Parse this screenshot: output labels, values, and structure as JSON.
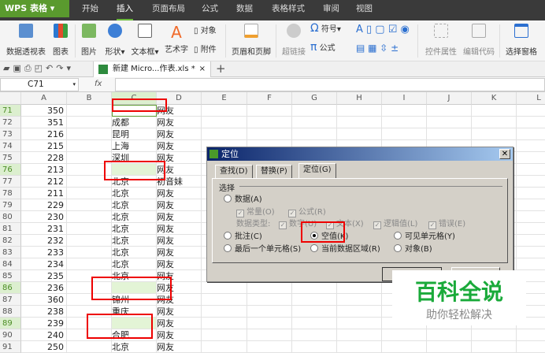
{
  "app": {
    "title": "WPS 表格",
    "menu_tabs": [
      "开始",
      "插入",
      "页面布局",
      "公式",
      "数据",
      "表格样式",
      "审阅",
      "视图"
    ],
    "active_tab": "插入"
  },
  "ribbon": {
    "pivot": "数据透视表",
    "chart": "图表",
    "picture": "图片",
    "shape": "形状",
    "textbox": "文本框",
    "wordart": "艺术字",
    "object": "对象",
    "attachment": "附件",
    "header_footer": "页眉和页脚",
    "hyperlink": "超链接",
    "symbol": "符号",
    "formula": "公式",
    "control_props": "控件属性",
    "edit_code": "编辑代码",
    "select_pane": "选择窗格"
  },
  "doc_tab": {
    "name": "新建 Micro...作表.xls *",
    "close": "×",
    "add": "+"
  },
  "formula_bar": {
    "name_box": "C71",
    "fx": "fx",
    "value": ""
  },
  "columns": [
    "A",
    "B",
    "C",
    "D",
    "E",
    "F",
    "G",
    "H",
    "I",
    "J",
    "K",
    "L"
  ],
  "rows": [
    {
      "n": "71",
      "a": "350",
      "c": "",
      "d": "网友",
      "sel": true
    },
    {
      "n": "72",
      "a": "351",
      "c": "成都",
      "d": "网友"
    },
    {
      "n": "73",
      "a": "216",
      "c": "昆明",
      "d": "网友"
    },
    {
      "n": "74",
      "a": "215",
      "c": "上海",
      "d": "网友"
    },
    {
      "n": "75",
      "a": "228",
      "c": "深圳",
      "d": "网友"
    },
    {
      "n": "76",
      "a": "213",
      "c": "",
      "d": "网友",
      "sel": true
    },
    {
      "n": "77",
      "a": "212",
      "c": "北京",
      "d": "初音妹"
    },
    {
      "n": "78",
      "a": "211",
      "c": "北京",
      "d": "网友"
    },
    {
      "n": "79",
      "a": "229",
      "c": "北京",
      "d": "网友"
    },
    {
      "n": "80",
      "a": "230",
      "c": "北京",
      "d": "网友"
    },
    {
      "n": "81",
      "a": "231",
      "c": "北京",
      "d": "网友"
    },
    {
      "n": "82",
      "a": "232",
      "c": "北京",
      "d": "网友"
    },
    {
      "n": "83",
      "a": "233",
      "c": "北京",
      "d": "网友"
    },
    {
      "n": "84",
      "a": "234",
      "c": "北京",
      "d": "网友"
    },
    {
      "n": "85",
      "a": "235",
      "c": "北京",
      "d": "网友"
    },
    {
      "n": "86",
      "a": "236",
      "c": "",
      "d": "网友",
      "sel": true
    },
    {
      "n": "87",
      "a": "360",
      "c": "锦州",
      "d": "网友"
    },
    {
      "n": "88",
      "a": "238",
      "c": "重庆",
      "d": "网友"
    },
    {
      "n": "89",
      "a": "239",
      "c": "",
      "d": "网友",
      "sel": true
    },
    {
      "n": "90",
      "a": "240",
      "c": "合肥",
      "d": "网友"
    },
    {
      "n": "91",
      "a": "250",
      "c": "北京",
      "d": "网友"
    }
  ],
  "dialog": {
    "title": "定位",
    "tabs": [
      "查找(D)",
      "替换(P)",
      "定位(G)"
    ],
    "active_tab": "定位(G)",
    "group": "选择",
    "data": "数据(A)",
    "constant": "常量(O)",
    "formula": "公式(R)",
    "data_type": "数据类型:",
    "number": "数字(U)",
    "text": "文本(X)",
    "logical": "逻辑值(L)",
    "error": "错误(E)",
    "comment": "批注(C)",
    "blank": "空值(K)",
    "visible": "可见单元格(Y)",
    "last_cell": "最后一个单元格(S)",
    "current_region": "当前数据区域(R)",
    "objects": "对象(B)",
    "selected": "空值(K)"
  },
  "watermark": {
    "title": "百科全说",
    "subtitle": "助你轻松解决"
  }
}
